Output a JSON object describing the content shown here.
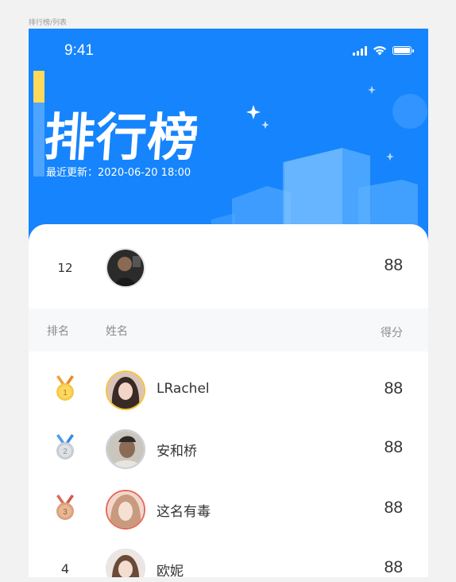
{
  "frame_label": "排行榜/列表",
  "status_bar": {
    "time": "9:41",
    "icons": [
      "cellular-signal-icon",
      "wifi-icon",
      "battery-icon"
    ]
  },
  "hero": {
    "title": "排行榜",
    "updated_text": "最近更新：2020-06-20 18:00",
    "background_color": "#1684fc",
    "accent_yellow": "#ffd95a"
  },
  "my_rank": {
    "rank": "12",
    "score": "88"
  },
  "table_header": {
    "rank": "排名",
    "name": "姓名",
    "score": "得分"
  },
  "rows": [
    {
      "rank": "1",
      "name": "LRachel",
      "score": "88",
      "medal": "gold",
      "avatar_border": "#f5c33b"
    },
    {
      "rank": "2",
      "name": "安和桥",
      "score": "88",
      "medal": "silver",
      "avatar_border": "#c9d0d8"
    },
    {
      "rank": "3",
      "name": "这名有毒",
      "score": "88",
      "medal": "bronze",
      "avatar_border": "#e86a5a"
    },
    {
      "rank": "4",
      "name": "欧妮",
      "score": "88",
      "medal": "none",
      "avatar_border": "#e5e5e5"
    }
  ]
}
